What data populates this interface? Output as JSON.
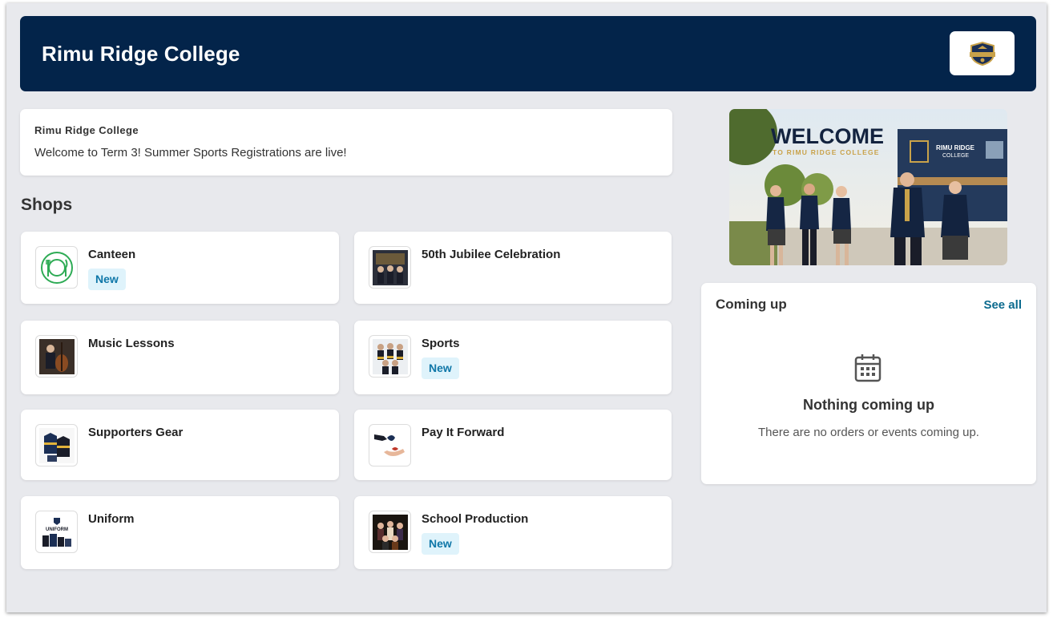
{
  "header": {
    "title": "Rimu Ridge College",
    "logo_icon": "school-crest-icon"
  },
  "notice": {
    "organization": "Rimu Ridge College",
    "message": "Welcome to Term 3! Summer Sports Registrations are live!"
  },
  "shops": {
    "heading": "Shops",
    "items": [
      {
        "name": "Canteen",
        "badge": "New",
        "icon": "plate-cutlery-icon"
      },
      {
        "name": "50th Jubilee Celebration",
        "badge": "",
        "icon": "jubilee-photo"
      },
      {
        "name": "Music Lessons",
        "badge": "",
        "icon": "cello-photo"
      },
      {
        "name": "Sports",
        "badge": "New",
        "icon": "sports-team-photo"
      },
      {
        "name": "Supporters Gear",
        "badge": "",
        "icon": "supporters-gear-photo"
      },
      {
        "name": "Pay It Forward",
        "badge": "",
        "icon": "giving-hands-photo"
      },
      {
        "name": "Uniform",
        "badge": "",
        "icon": "uniform-photo"
      },
      {
        "name": "School Production",
        "badge": "New",
        "icon": "production-photo"
      }
    ]
  },
  "hero": {
    "headline": "WELCOME",
    "subline": "TO RIMU RIDGE COLLEGE",
    "sign_line1": "RIMU RIDGE",
    "sign_line2": "COLLEGE"
  },
  "upcoming": {
    "title": "Coming up",
    "see_all": "See all",
    "empty_icon": "calendar-icon",
    "empty_title": "Nothing coming up",
    "empty_subtitle": "There are no orders or events coming up."
  },
  "colors": {
    "header_bg": "#03244a",
    "page_bg": "#e8e9ed",
    "badge_bg": "#dff3fb",
    "badge_text": "#0f77a8",
    "link": "#0b6a8e",
    "accent_gold": "#c9a24a"
  }
}
